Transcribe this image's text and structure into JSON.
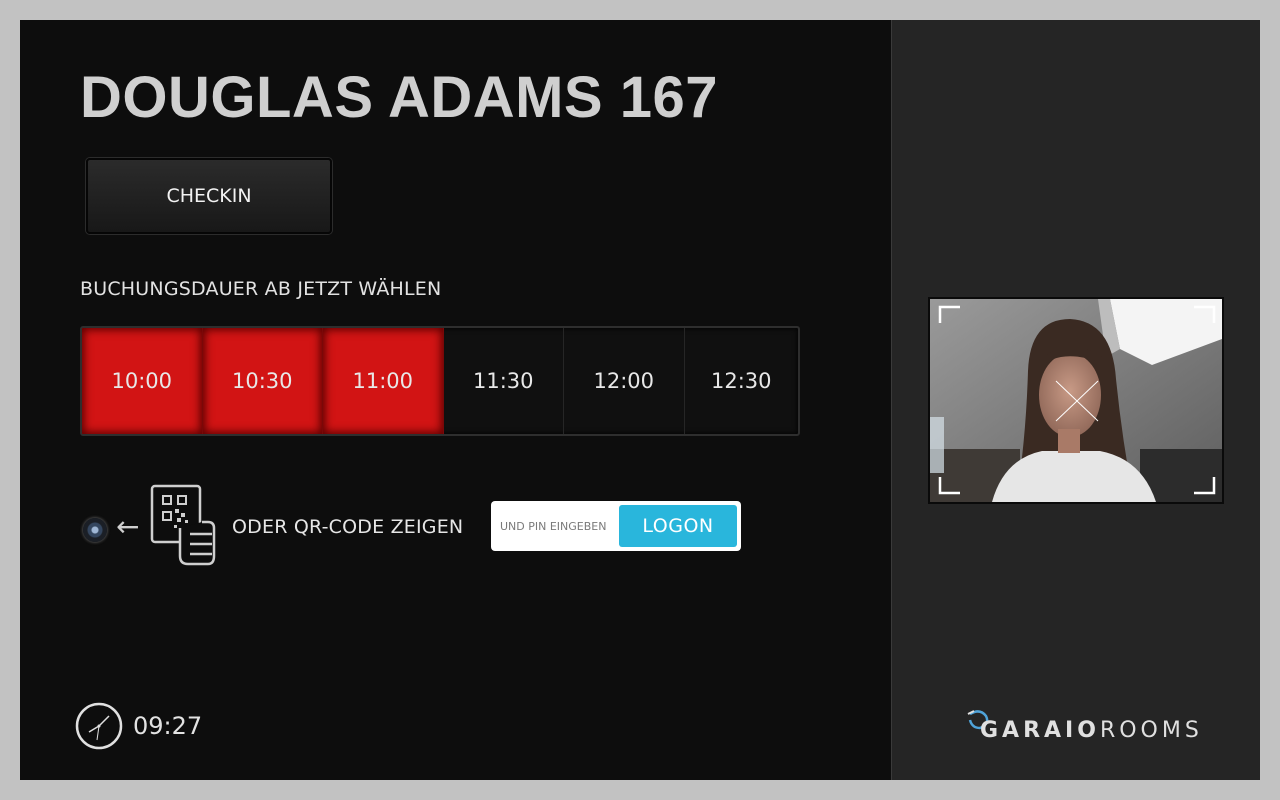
{
  "room": {
    "title": "DOUGLAS ADAMS 167"
  },
  "checkin": {
    "label": "CHECKIN"
  },
  "booking": {
    "label": "BUCHUNGSDAUER AB JETZT WÄHLEN",
    "slots": [
      {
        "time": "10:00",
        "selected": true
      },
      {
        "time": "10:30",
        "selected": true
      },
      {
        "time": "11:00",
        "selected": true
      },
      {
        "time": "11:30",
        "selected": false
      },
      {
        "time": "12:00",
        "selected": false
      },
      {
        "time": "12:30",
        "selected": false
      }
    ]
  },
  "login": {
    "qr_label": "ODER QR-CODE ZEIGEN",
    "pin_placeholder": "UND PIN EINGEBEN",
    "logon_label": "LOGON",
    "arrow_glyph": "←"
  },
  "clock": {
    "time": "09:27"
  },
  "brand": {
    "name_strong": "GARAIO",
    "name_light": "ROOMS"
  },
  "colors": {
    "selected_slot": "#d21414",
    "logon_button": "#29b6dc",
    "brand_accent": "#4fa3d9"
  },
  "icons": {
    "camera": "camera-lens-icon",
    "arrow": "arrow-left-icon",
    "qr_hand": "qr-code-hand-icon",
    "clock": "clock-icon",
    "brand": "garaio-logo-icon",
    "face_target": "face-target-icon"
  }
}
